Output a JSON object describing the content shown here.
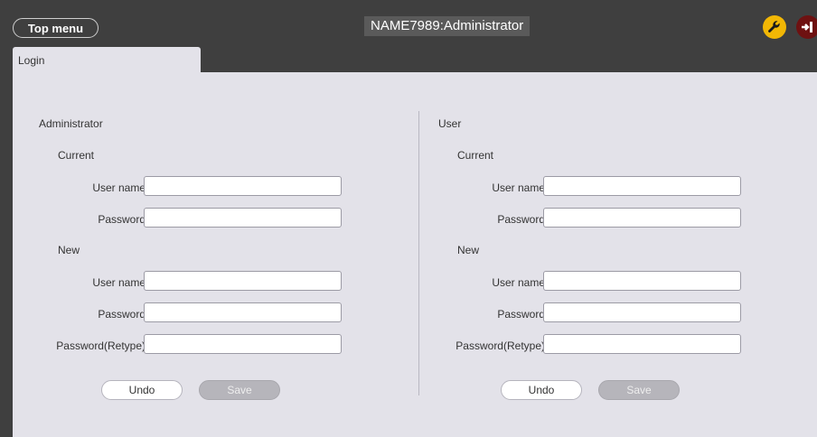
{
  "header": {
    "top_menu_label": "Top menu",
    "title": "NAME7989:Administrator",
    "settings_icon": "wrench-icon",
    "logout_icon": "logout-icon",
    "colors": {
      "settings": "#f2b705",
      "logout": "#6e1111"
    }
  },
  "tabs": [
    {
      "label": "Login"
    }
  ],
  "admin": {
    "title": "Administrator",
    "current_label": "Current",
    "new_label": "New",
    "user_name_label": "User name",
    "password_label": "Password",
    "retype_label": "Password(Retype)",
    "values": {
      "current_user": "",
      "current_password": "",
      "new_user": "",
      "new_password": "",
      "new_retype": ""
    },
    "undo_label": "Undo",
    "save_label": "Save"
  },
  "user": {
    "title": "User",
    "current_label": "Current",
    "new_label": "New",
    "user_name_label": "User name",
    "password_label": "Password",
    "retype_label": "Password(Retype)",
    "values": {
      "current_user": "",
      "current_password": "",
      "new_user": "",
      "new_password": "",
      "new_retype": ""
    },
    "undo_label": "Undo",
    "save_label": "Save"
  }
}
